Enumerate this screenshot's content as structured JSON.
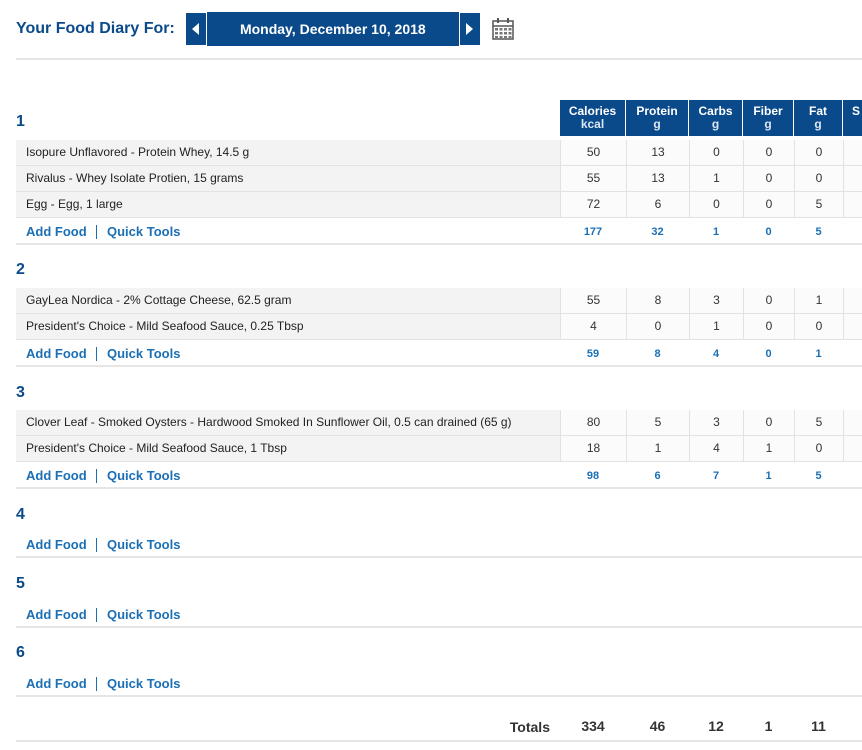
{
  "header": {
    "title": "Your Food Diary For:",
    "date": "Monday, December 10, 2018"
  },
  "columns": [
    {
      "label": "Calories",
      "unit": "kcal"
    },
    {
      "label": "Protein",
      "unit": "g"
    },
    {
      "label": "Carbs",
      "unit": "g"
    },
    {
      "label": "Fiber",
      "unit": "g"
    },
    {
      "label": "Fat",
      "unit": "g"
    },
    {
      "label": "S",
      "unit": ""
    }
  ],
  "actions": {
    "add_food": "Add Food",
    "quick_tools": "Quick Tools"
  },
  "meals": [
    {
      "title": "1",
      "foods": [
        {
          "name": "Isopure Unflavored - Protein Whey, 14.5 g",
          "values": [
            "50",
            "13",
            "0",
            "0",
            "0"
          ]
        },
        {
          "name": "Rivalus - Whey Isolate Protien, 15 grams",
          "values": [
            "55",
            "13",
            "1",
            "0",
            "0"
          ]
        },
        {
          "name": "Egg - Egg, 1 large",
          "values": [
            "72",
            "6",
            "0",
            "0",
            "5"
          ]
        }
      ],
      "totals": [
        "177",
        "32",
        "1",
        "0",
        "5"
      ]
    },
    {
      "title": "2",
      "foods": [
        {
          "name": "GayLea Nordica - 2% Cottage Cheese, 62.5 gram",
          "values": [
            "55",
            "8",
            "3",
            "0",
            "1"
          ]
        },
        {
          "name": "President's Choice - Mild Seafood Sauce, 0.25 Tbsp",
          "values": [
            "4",
            "0",
            "1",
            "0",
            "0"
          ]
        }
      ],
      "totals": [
        "59",
        "8",
        "4",
        "0",
        "1"
      ]
    },
    {
      "title": "3",
      "foods": [
        {
          "name": "Clover Leaf - Smoked Oysters - Hardwood Smoked In Sunflower Oil, 0.5 can drained (65 g)",
          "values": [
            "80",
            "5",
            "3",
            "0",
            "5"
          ]
        },
        {
          "name": "President's Choice - Mild Seafood Sauce, 1 Tbsp",
          "values": [
            "18",
            "1",
            "4",
            "1",
            "0"
          ]
        }
      ],
      "totals": [
        "98",
        "6",
        "7",
        "1",
        "5"
      ]
    },
    {
      "title": "4",
      "foods": [],
      "totals": null
    },
    {
      "title": "5",
      "foods": [],
      "totals": null
    },
    {
      "title": "6",
      "foods": [],
      "totals": null
    }
  ],
  "totals": {
    "label": "Totals",
    "values": [
      "334",
      "46",
      "12",
      "1",
      "11"
    ]
  },
  "colors": {
    "brand": "#0a4a8a",
    "link": "#1b6fb5"
  }
}
